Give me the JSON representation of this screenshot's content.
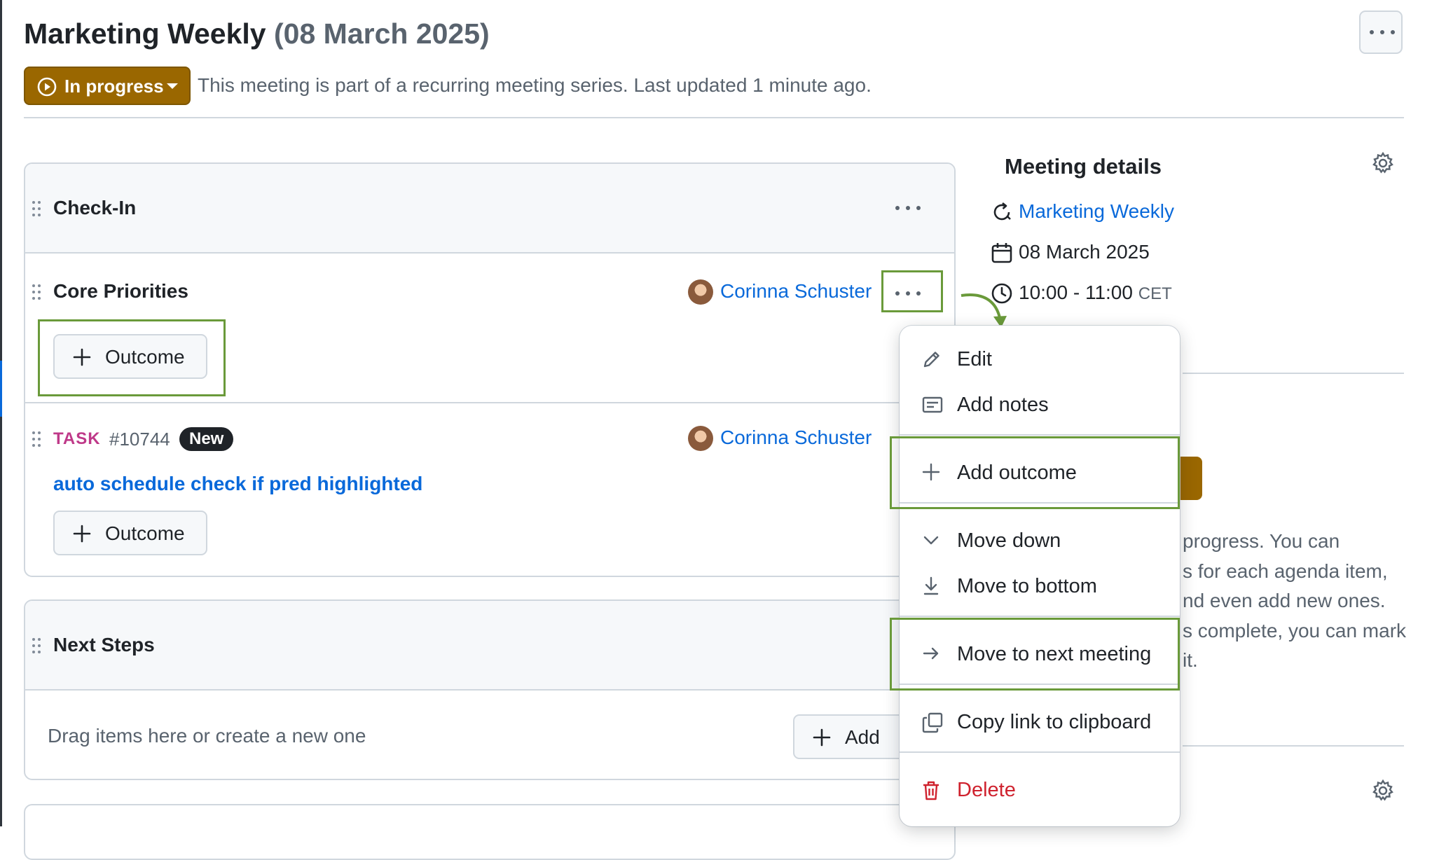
{
  "header": {
    "title": "Marketing Weekly",
    "date": "(08 March 2025)",
    "status_label": "In progress",
    "status_text": "This meeting is part of a recurring meeting series. Last updated 1 minute ago."
  },
  "agenda": {
    "checkin": {
      "title": "Check-In"
    },
    "core": {
      "title": "Core Priorities",
      "person": "Corinna Schuster",
      "outcome_label": "Outcome"
    },
    "task": {
      "tag": "TASK",
      "number": "#10744",
      "badge": "New",
      "person": "Corinna Schuster",
      "title": "auto schedule check if pred highlighted",
      "outcome_label": "Outcome"
    },
    "next_steps": {
      "title": "Next Steps",
      "empty_text": "Drag items here or create a new one",
      "add_label": "Add"
    }
  },
  "meeting_details": {
    "title": "Meeting details",
    "series": "Marketing Weekly",
    "date": "08 March 2025",
    "time": "10:00 - 11:00",
    "timezone": "CET",
    "status_help_lines": [
      "progress. You can",
      "s for each agenda item,",
      "nd even add new ones.",
      "s complete, you can mark",
      "it."
    ]
  },
  "menu": {
    "items": [
      {
        "label": "Edit",
        "icon": "pencil-icon"
      },
      {
        "label": "Add notes",
        "icon": "note-icon"
      },
      {
        "label": "Add outcome",
        "icon": "plus-icon"
      },
      {
        "label": "Move down",
        "icon": "chevron-down-icon"
      },
      {
        "label": "Move to bottom",
        "icon": "move-to-bottom-icon"
      },
      {
        "label": "Move to next meeting",
        "icon": "arrow-right-icon"
      },
      {
        "label": "Copy link to clipboard",
        "icon": "copy-icon"
      },
      {
        "label": "Delete",
        "icon": "trash-icon"
      }
    ]
  },
  "colors": {
    "status": "#9a6700",
    "link": "#0969da",
    "highlight": "#6a9a3a",
    "danger": "#cf222e",
    "task_tag": "#bf3989"
  }
}
